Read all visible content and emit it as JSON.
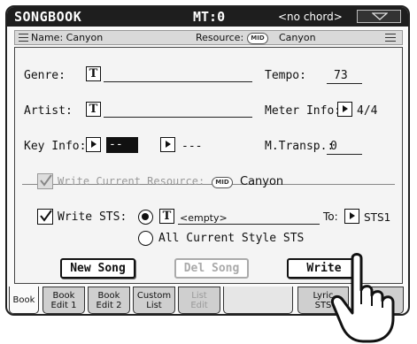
{
  "titlebar": {
    "app": "SONGBOOK",
    "mt": "MT:0",
    "chord": "<no chord>"
  },
  "subbar": {
    "name": "Name: Canyon",
    "resource_label": "Resource:",
    "resource_badge": "MID",
    "resource_value": "Canyon"
  },
  "fields": {
    "genre_label": "Genre:",
    "genre_t": "T",
    "artist_label": "Artist:",
    "artist_t": "T",
    "keyinfo_label": "Key Info:",
    "keyinfo_value1": "--",
    "keyinfo_value2": "---",
    "tempo_label": "Tempo:",
    "tempo_value": "73",
    "meter_label": "Meter Info:",
    "meter_value": "4/4",
    "mtransp_label": "M.Transp.:",
    "mtransp_value": "0"
  },
  "write_resource": {
    "label": "Write Current Resource:",
    "badge": "MID",
    "value": "Canyon",
    "checked": true,
    "disabled": true
  },
  "write_sts": {
    "label": "Write STS:",
    "t": "T",
    "value": "<empty>",
    "to_label": "To:",
    "to_value": "STS1",
    "checked": true
  },
  "all_style_sts": "All Current Style STS",
  "buttons": {
    "new_song": "New Song",
    "del_song": "Del Song",
    "write": "Write"
  },
  "tabs": [
    {
      "line1": "Book",
      "line2": ""
    },
    {
      "line1": "Book",
      "line2": "Edit 1"
    },
    {
      "line1": "Book",
      "line2": "Edit 2"
    },
    {
      "line1": "Custom",
      "line2": "List"
    },
    {
      "line1": "List",
      "line2": "Edit"
    },
    {
      "line1": "Lyric",
      "line2": "STS"
    },
    {
      "line1": "",
      "line2": ""
    }
  ],
  "colors": {
    "titlebar": "#1e1e1e",
    "panel": "#f4f4f4"
  }
}
